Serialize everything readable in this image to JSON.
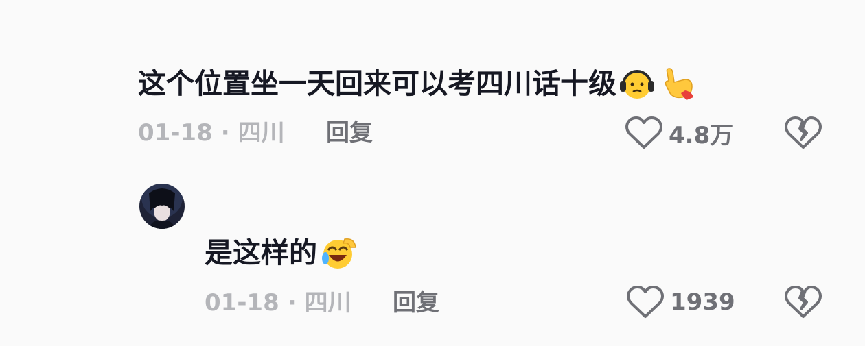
{
  "comments": [
    {
      "text": "这个位置坐一天回来可以考四川话十级",
      "emojis": [
        "headphones-face-emoji",
        "pointing-hand-emoji"
      ],
      "date": "01-18",
      "separator": "·",
      "location": "四川",
      "reply_label": "回复",
      "like_count": "4.8万"
    },
    {
      "text": "是这样的",
      "emojis": [
        "laughing-crying-face-emoji"
      ],
      "date": "01-18",
      "separator": "·",
      "location": "四川",
      "reply_label": "回复",
      "like_count": "1939"
    }
  ],
  "colors": {
    "text": "#161823",
    "meta": "#b4b5b9",
    "action": "#6f7076",
    "background": "#fafafa"
  }
}
